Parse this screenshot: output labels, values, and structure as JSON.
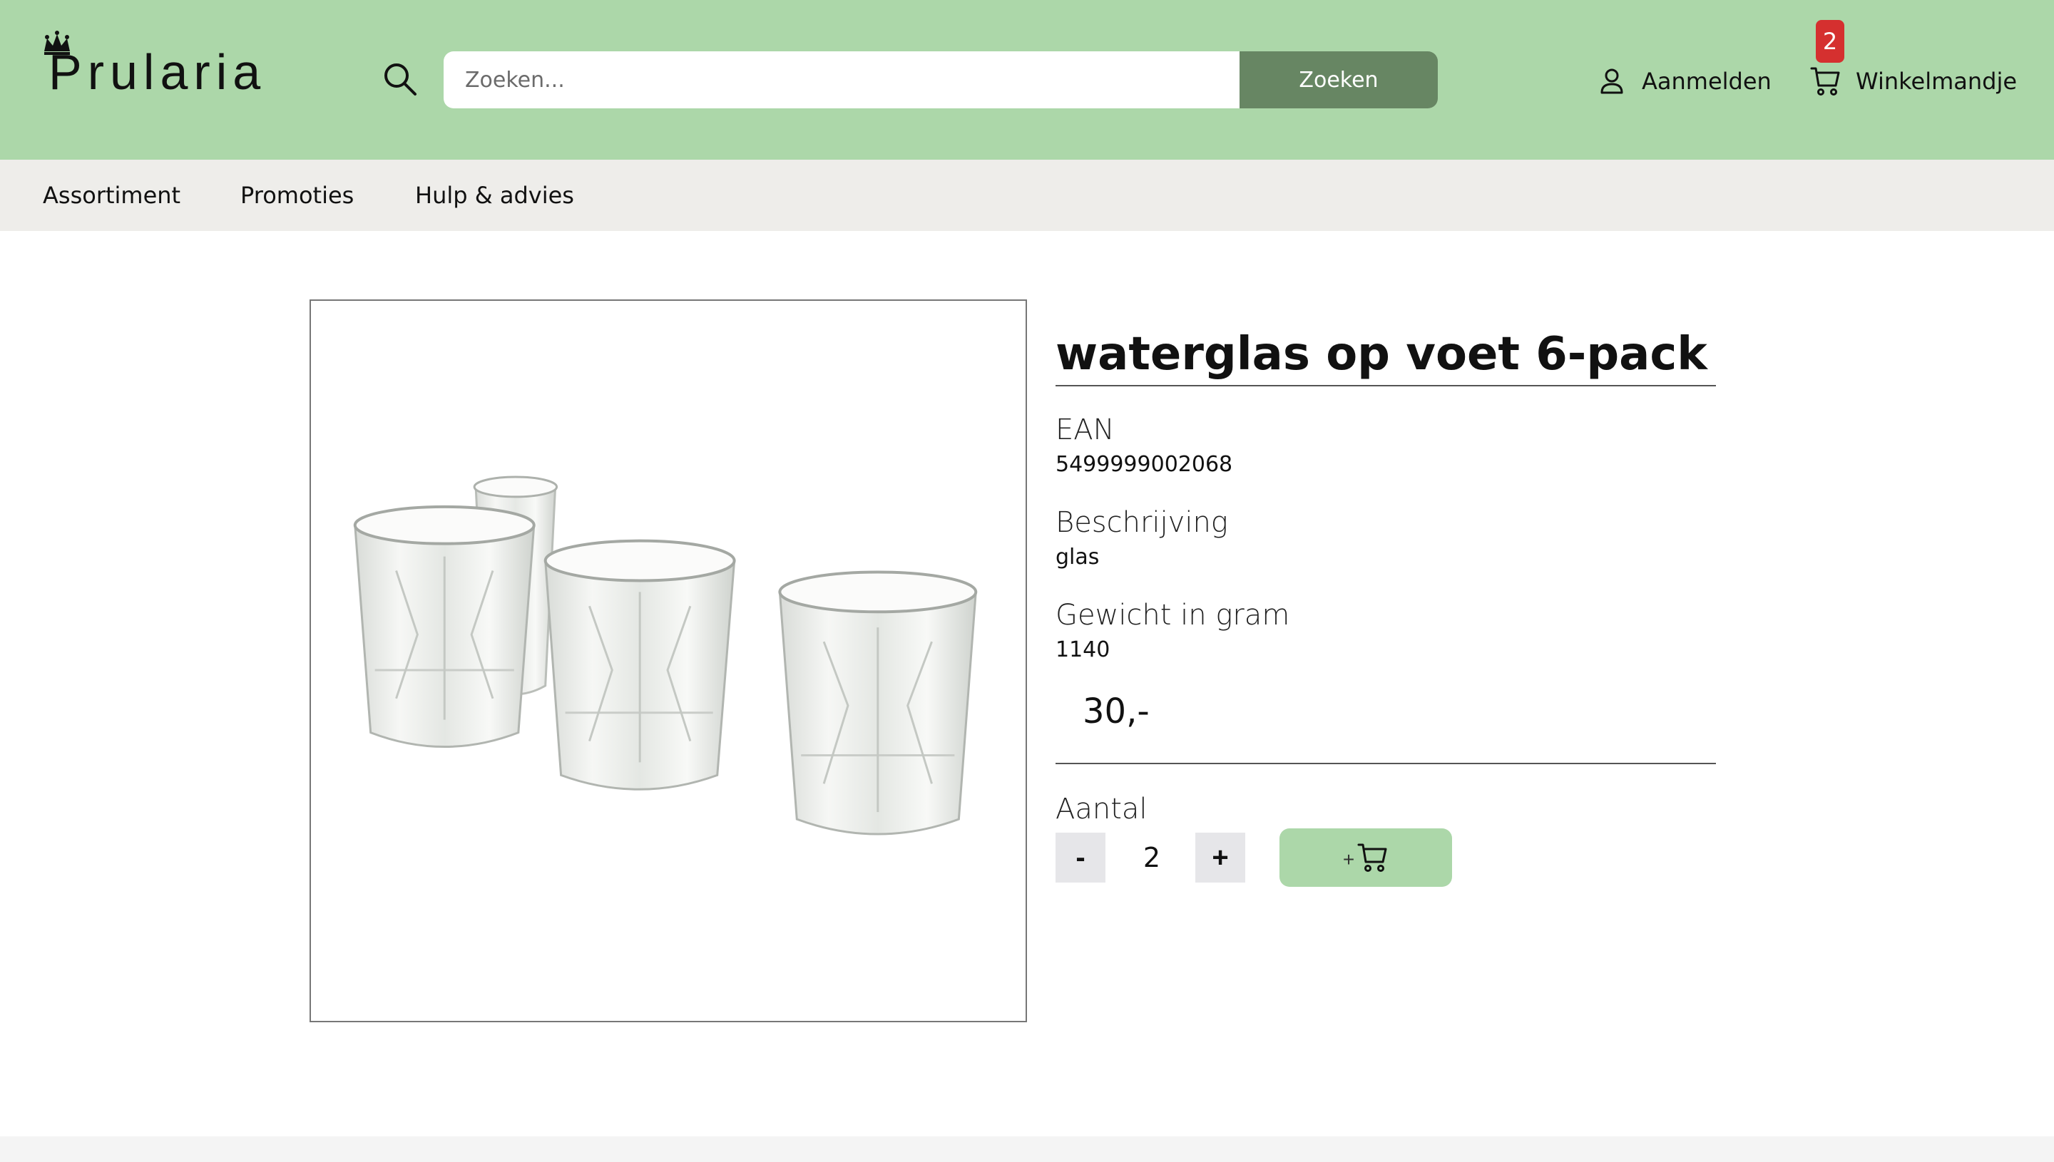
{
  "brand": {
    "name": "Prularia"
  },
  "search": {
    "placeholder": "Zoeken...",
    "button_label": "Zoeken"
  },
  "account": {
    "login_label": "Aanmelden"
  },
  "cart": {
    "label": "Winkelmandje",
    "count": "2"
  },
  "nav": {
    "items": [
      {
        "label": "Assortiment"
      },
      {
        "label": "Promoties"
      },
      {
        "label": "Hulp & advies"
      }
    ]
  },
  "product": {
    "title": "waterglas op voet 6-pack",
    "fields": [
      {
        "label": "EAN",
        "value": "5499999002068"
      },
      {
        "label": "Beschrijving",
        "value": "glas"
      },
      {
        "label": "Gewicht in gram",
        "value": "1140"
      }
    ],
    "price": "30,-",
    "quantity_label": "Aantal",
    "quantity": "2",
    "minus_label": "-",
    "plus_label": "+",
    "add_to_cart_plus": "+"
  },
  "colors": {
    "header": "#acd7a9",
    "search_button": "#678663",
    "nav": "#eeedea",
    "badge": "#d5302f"
  },
  "icons": [
    "crown-icon",
    "search-icon",
    "user-icon",
    "cart-icon"
  ]
}
